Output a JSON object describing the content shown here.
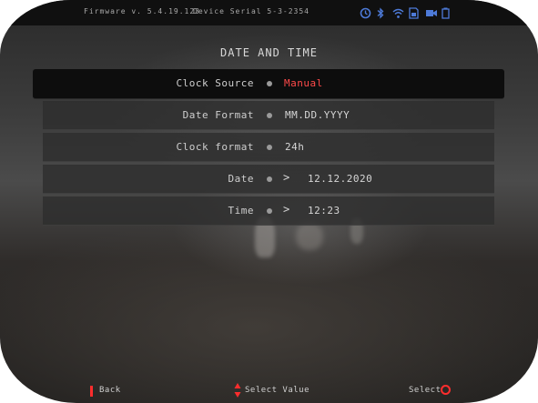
{
  "status_bar": {
    "firmware": "Firmware v. 5.4.19.123",
    "serial": "Device Serial 5-3-2354",
    "icons": [
      "timer-icon",
      "bluetooth-icon",
      "wifi-icon",
      "sd-card-icon",
      "video-camera-icon",
      "battery-icon"
    ]
  },
  "menu": {
    "title": "DATE AND TIME",
    "rows": [
      {
        "label": "Clock Source",
        "value": "Manual"
      },
      {
        "label": "Date Format",
        "value": "MM.DD.YYYY"
      },
      {
        "label": "Clock format",
        "value": "24h"
      },
      {
        "label": "Date",
        "value": "12.12.2020"
      },
      {
        "label": "Time",
        "value": "12:23"
      }
    ]
  },
  "footer": {
    "back": "Back",
    "select_value": "Select Value",
    "select": "Select"
  },
  "colors": {
    "accent": "#ff2d2d",
    "icon": "#4d7ad8"
  }
}
